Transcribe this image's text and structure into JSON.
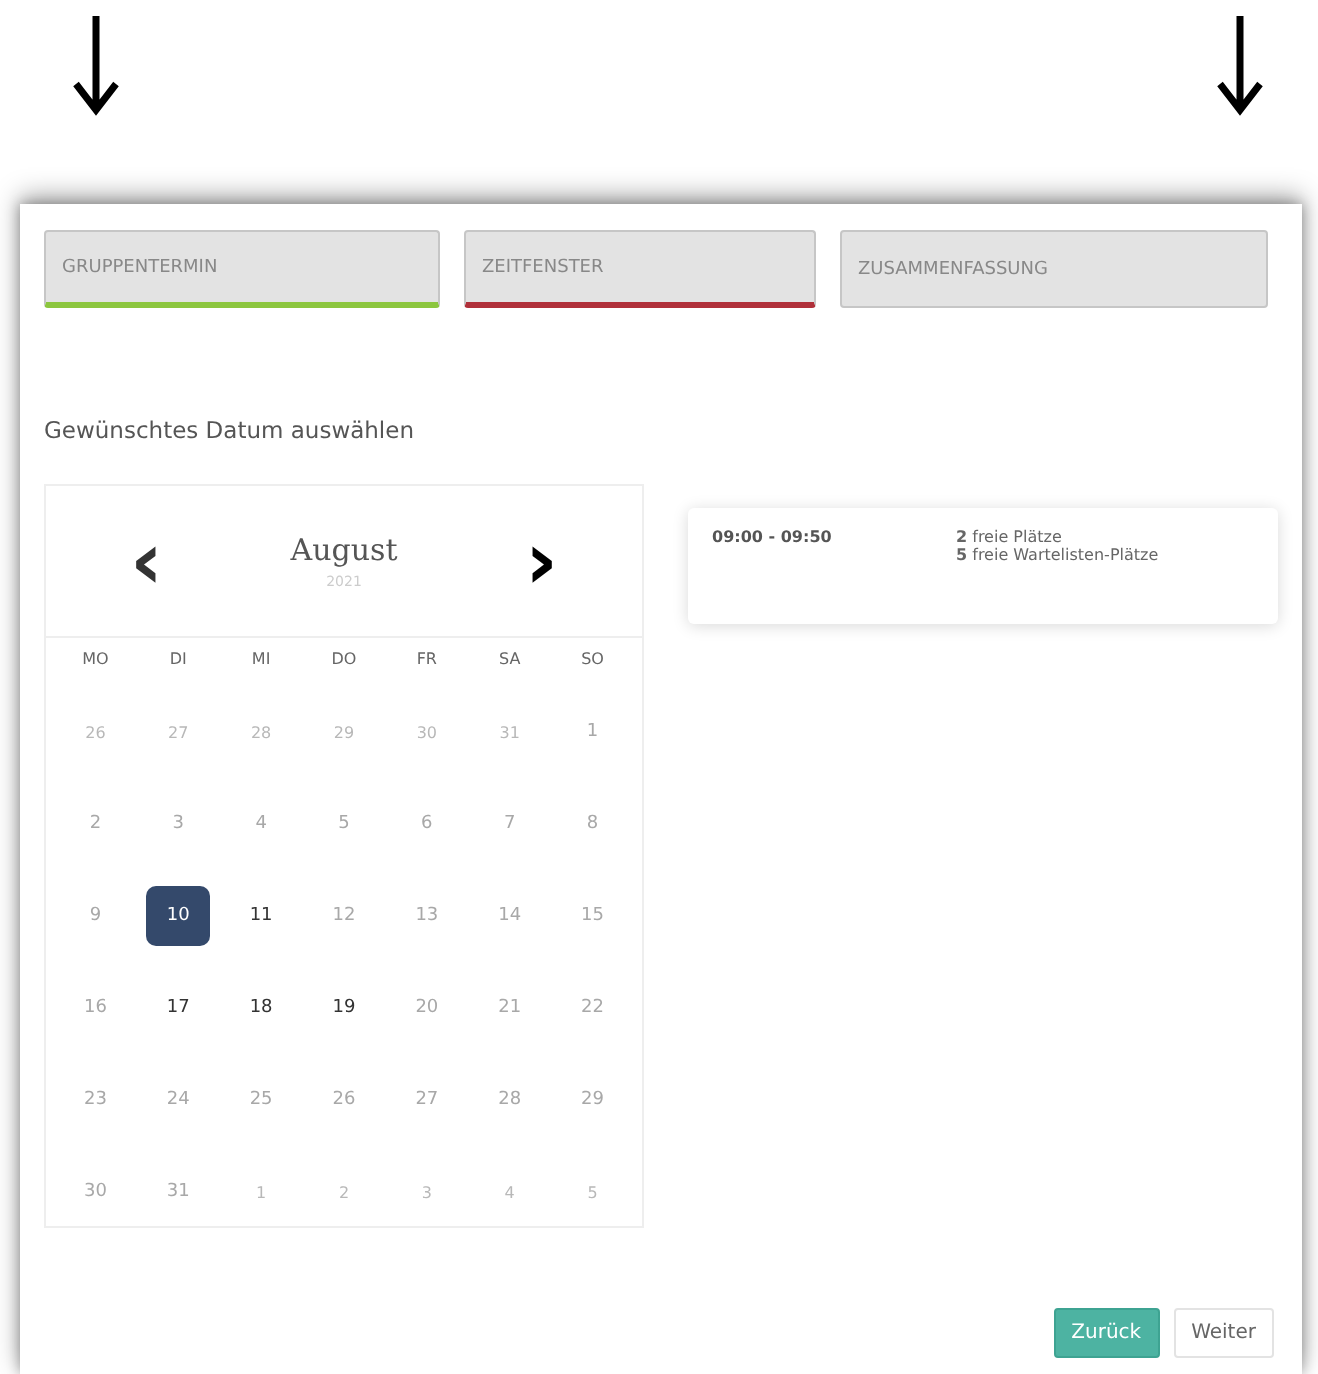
{
  "tabs": [
    {
      "label": "GRUPPENTERMIN",
      "color": "#8cc63f"
    },
    {
      "label": "ZEITFENSTER",
      "color": "#b0303a"
    },
    {
      "label": "ZUSAMMENFASSUNG"
    }
  ],
  "heading": "Gewünschtes Datum auswählen",
  "calendar": {
    "prev": "‹",
    "next": "›",
    "month": "August",
    "year": "2021",
    "weekdays": [
      "MO",
      "DI",
      "MI",
      "DO",
      "FR",
      "SA",
      "SO"
    ],
    "days": [
      {
        "label": "26",
        "outside": true,
        "available": false,
        "selected": false
      },
      {
        "label": "27",
        "outside": true,
        "available": false,
        "selected": false
      },
      {
        "label": "28",
        "outside": true,
        "available": false,
        "selected": false
      },
      {
        "label": "29",
        "outside": true,
        "available": false,
        "selected": false
      },
      {
        "label": "30",
        "outside": true,
        "available": false,
        "selected": false
      },
      {
        "label": "31",
        "outside": true,
        "available": false,
        "selected": false
      },
      {
        "label": "1",
        "outside": false,
        "available": false,
        "selected": false
      },
      {
        "label": "2",
        "outside": false,
        "available": false,
        "selected": false
      },
      {
        "label": "3",
        "outside": false,
        "available": false,
        "selected": false
      },
      {
        "label": "4",
        "outside": false,
        "available": false,
        "selected": false
      },
      {
        "label": "5",
        "outside": false,
        "available": false,
        "selected": false
      },
      {
        "label": "6",
        "outside": false,
        "available": false,
        "selected": false
      },
      {
        "label": "7",
        "outside": false,
        "available": false,
        "selected": false
      },
      {
        "label": "8",
        "outside": false,
        "available": false,
        "selected": false
      },
      {
        "label": "9",
        "outside": false,
        "available": false,
        "selected": false
      },
      {
        "label": "10",
        "outside": false,
        "available": true,
        "selected": true
      },
      {
        "label": "11",
        "outside": false,
        "available": true,
        "selected": false
      },
      {
        "label": "12",
        "outside": false,
        "available": false,
        "selected": false
      },
      {
        "label": "13",
        "outside": false,
        "available": false,
        "selected": false
      },
      {
        "label": "14",
        "outside": false,
        "available": false,
        "selected": false
      },
      {
        "label": "15",
        "outside": false,
        "available": false,
        "selected": false
      },
      {
        "label": "16",
        "outside": false,
        "available": false,
        "selected": false
      },
      {
        "label": "17",
        "outside": false,
        "available": true,
        "selected": false
      },
      {
        "label": "18",
        "outside": false,
        "available": true,
        "selected": false
      },
      {
        "label": "19",
        "outside": false,
        "available": true,
        "selected": false
      },
      {
        "label": "20",
        "outside": false,
        "available": false,
        "selected": false
      },
      {
        "label": "21",
        "outside": false,
        "available": false,
        "selected": false
      },
      {
        "label": "22",
        "outside": false,
        "available": false,
        "selected": false
      },
      {
        "label": "23",
        "outside": false,
        "available": false,
        "selected": false
      },
      {
        "label": "24",
        "outside": false,
        "available": false,
        "selected": false
      },
      {
        "label": "25",
        "outside": false,
        "available": false,
        "selected": false
      },
      {
        "label": "26",
        "outside": false,
        "available": false,
        "selected": false
      },
      {
        "label": "27",
        "outside": false,
        "available": false,
        "selected": false
      },
      {
        "label": "28",
        "outside": false,
        "available": false,
        "selected": false
      },
      {
        "label": "29",
        "outside": false,
        "available": false,
        "selected": false
      },
      {
        "label": "30",
        "outside": false,
        "available": false,
        "selected": false
      },
      {
        "label": "31",
        "outside": false,
        "available": false,
        "selected": false
      },
      {
        "label": "1",
        "outside": true,
        "available": false,
        "selected": false
      },
      {
        "label": "2",
        "outside": true,
        "available": false,
        "selected": false
      },
      {
        "label": "3",
        "outside": true,
        "available": false,
        "selected": false
      },
      {
        "label": "4",
        "outside": true,
        "available": false,
        "selected": false
      },
      {
        "label": "5",
        "outside": true,
        "available": false,
        "selected": false
      }
    ]
  },
  "slots": [
    {
      "time": "09:00 - 09:50",
      "free": "**2** freie Plätze",
      "waitlist": "**5** freie Wartelisten-Plätze"
    }
  ],
  "buttons": [
    {
      "label": "Zurück",
      "kind": "primary"
    },
    {
      "label": "Weiter",
      "kind": "secondary"
    }
  ]
}
